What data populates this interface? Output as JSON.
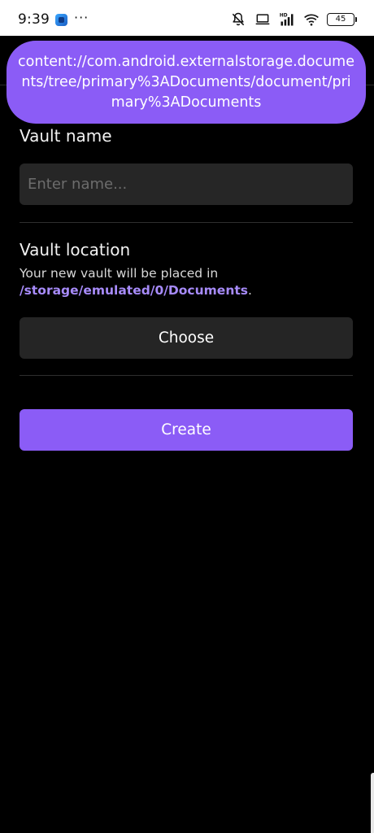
{
  "status_bar": {
    "time": "9:39",
    "dots": "···",
    "battery": "45",
    "icons": [
      "app-icon",
      "mute-icon",
      "laptop-icon",
      "hd-signal-icon",
      "wifi-icon",
      "battery-icon"
    ]
  },
  "toast": {
    "text": "content://com.android.externalstorage.documents/tree/primary%3ADocuments/document/primary%3ADocuments"
  },
  "vault_name": {
    "label": "Vault name",
    "placeholder": "Enter name...",
    "value": ""
  },
  "vault_location": {
    "label": "Vault location",
    "description_prefix": "Your new vault will be placed in",
    "path": "/storage/emulated/0/Documents",
    "description_suffix": ".",
    "choose_label": "Choose"
  },
  "create_label": "Create",
  "colors": {
    "accent": "#8b5cf6",
    "path_text": "#a78bfa",
    "field_bg": "#262626",
    "background": "#000000"
  }
}
